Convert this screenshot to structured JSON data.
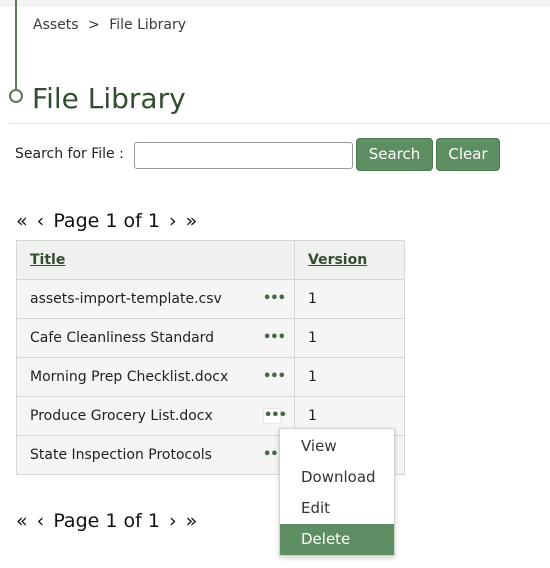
{
  "breadcrumb": {
    "root": "Assets",
    "separator": ">",
    "current": "File Library"
  },
  "page": {
    "title": "File Library"
  },
  "search": {
    "label": "Search for File :",
    "value": "",
    "placeholder": "",
    "search_button": "Search",
    "clear_button": "Clear"
  },
  "pagination": {
    "first": "«",
    "prev": "‹",
    "text": "Page 1 of 1",
    "next": "›",
    "last": "»"
  },
  "table": {
    "headers": {
      "title": "Title",
      "version": "Version"
    },
    "rows": [
      {
        "title": "assets-import-template.csv",
        "actions": "•••",
        "version": "1"
      },
      {
        "title": "Cafe Cleanliness Standard",
        "actions": "•••",
        "version": "1"
      },
      {
        "title": "Morning Prep Checklist.docx",
        "actions": "•••",
        "version": "1"
      },
      {
        "title": "Produce Grocery List.docx",
        "actions": "•••",
        "version": "1"
      },
      {
        "title": "State Inspection Protocols",
        "actions": "•••",
        "version": ""
      }
    ]
  },
  "context_menu": {
    "items": [
      "View",
      "Download",
      "Edit",
      "Delete"
    ],
    "highlighted": "Delete"
  },
  "colors": {
    "accent": "#5e8f62",
    "title_text": "#334d31",
    "header_bg": "#eef1ee",
    "row_bg": "#f5f5f5"
  }
}
